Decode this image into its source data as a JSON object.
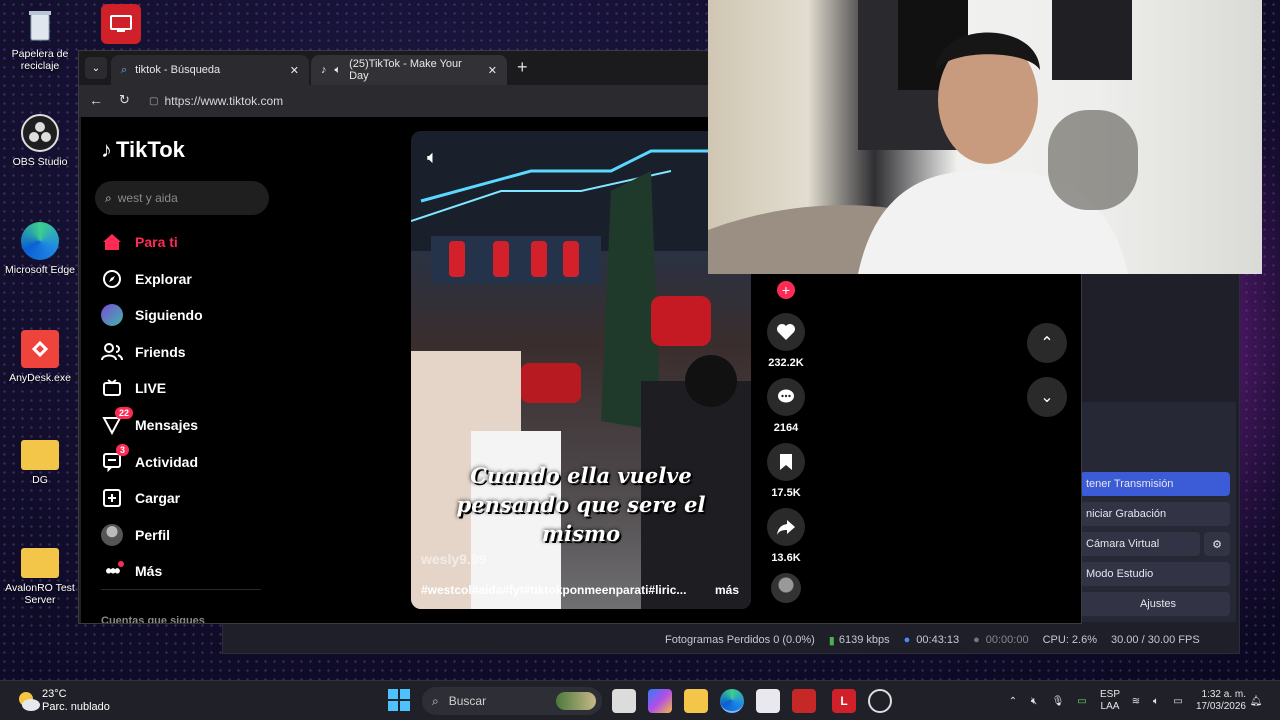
{
  "desktop": {
    "icons": [
      {
        "label": "Papelera de reciclaje",
        "icon": "recycle-bin-icon"
      },
      {
        "label": "OBS Studio",
        "icon": "obs-icon"
      },
      {
        "label": "Microsoft Edge",
        "icon": "edge-icon"
      },
      {
        "label": "AnyDesk.exe",
        "icon": "anydesk-icon"
      },
      {
        "label": "DG",
        "icon": "folder-icon"
      },
      {
        "label": "AvalonRO Test Server",
        "icon": "folder-icon"
      }
    ]
  },
  "browser": {
    "tabs": [
      {
        "label": "tiktok - Búsqueda",
        "icon": "search-icon"
      },
      {
        "label": "(25)TikTok - Make Your Day",
        "icon": "tiktok-icon"
      }
    ],
    "url": "https://www.tiktok.com"
  },
  "tiktok": {
    "logo": "TikTok",
    "search_placeholder": "west y aida",
    "nav": [
      {
        "label": "Para ti",
        "icon": "home-icon",
        "badge": ""
      },
      {
        "label": "Explorar",
        "icon": "compass-icon",
        "badge": ""
      },
      {
        "label": "Siguiendo",
        "icon": "following-avatar-icon",
        "badge": ""
      },
      {
        "label": "Friends",
        "icon": "friends-icon",
        "badge": ""
      },
      {
        "label": "LIVE",
        "icon": "live-icon",
        "badge": ""
      },
      {
        "label": "Mensajes",
        "icon": "messages-icon",
        "badge": "22"
      },
      {
        "label": "Actividad",
        "icon": "activity-icon",
        "badge": "3"
      },
      {
        "label": "Cargar",
        "icon": "upload-icon",
        "badge": ""
      },
      {
        "label": "Perfil",
        "icon": "profile-avatar-icon",
        "badge": ""
      },
      {
        "label": "Más",
        "icon": "more-icon",
        "badge": ""
      }
    ],
    "following_section": "Cuentas que sigues",
    "video": {
      "caption": "Cuando ella vuelve pensando que sere el mismo",
      "watermark": "wesly9.99",
      "hashtags": "#westcol#aida#fyt#tiktokponmeenparati#liric...",
      "more": "más"
    },
    "actions": {
      "likes": "232.2K",
      "comments": "2164",
      "saves": "17.5K",
      "shares": "13.6K"
    }
  },
  "obs": {
    "buttons": [
      "tener Transmisión",
      "niciar Grabación",
      "Cámara Virtual",
      "Modo Estudio",
      "Ajustes"
    ],
    "status": {
      "dropped_frames": "Fotogramas Perdidos 0 (0.0%)",
      "bitrate": "6139 kbps",
      "stream_time": "00:43:13",
      "record_time": "00:00:00",
      "cpu": "CPU: 2.6%",
      "fps": "30.00 / 30.00 FPS"
    }
  },
  "taskbar": {
    "weather_temp": "23°C",
    "weather_desc": "Parc. nublado",
    "search_label": "Buscar",
    "lang_1": "ESP",
    "lang_2": "LAA",
    "time": "1:32 a. m.",
    "date": "17/03/2026"
  },
  "colors": {
    "tiktok_accent": "#fe2c55",
    "obs_primary": "#3c5bd6"
  }
}
